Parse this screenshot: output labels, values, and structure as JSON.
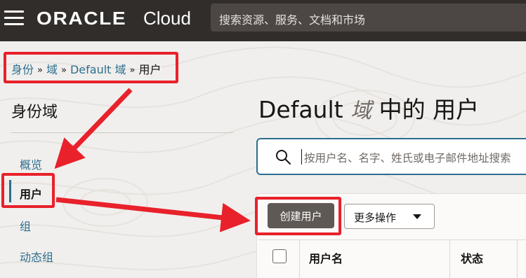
{
  "topbar": {
    "brand": "ORACLE",
    "product": "Cloud",
    "search_placeholder": "搜索资源、服务、文档和市场"
  },
  "breadcrumb": {
    "items": [
      "身份",
      "域",
      "Default 域"
    ],
    "current": "用户",
    "separator": "»"
  },
  "sidebar": {
    "title": "身份域",
    "items": [
      {
        "label": "概览",
        "active": false
      },
      {
        "label": "用户",
        "active": true
      },
      {
        "label": "组",
        "active": false
      },
      {
        "label": "动态组",
        "active": false
      }
    ]
  },
  "main": {
    "title_prefix": "Default",
    "title_italic": "域",
    "title_suffix": "中的 用户",
    "search_placeholder": "按用户名、名字、姓氏或电子邮件地址搜索",
    "create_button": "创建用户",
    "more_actions": "更多操作",
    "columns": [
      "用户名",
      "状态"
    ]
  },
  "colors": {
    "topbar": "#312d2a",
    "link": "#2c6f8e",
    "annotation_red": "#e8212b",
    "primary_button": "#5e5954"
  }
}
